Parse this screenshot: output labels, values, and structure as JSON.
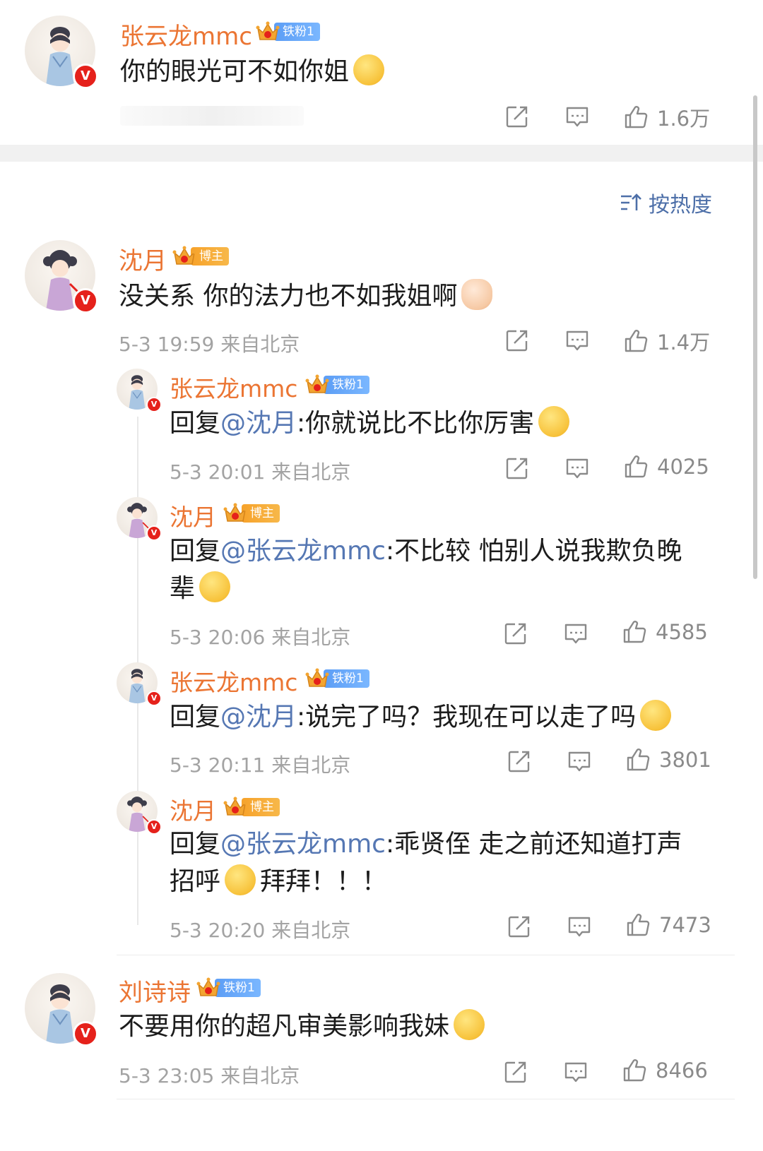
{
  "top_comment": {
    "name": "张云龙mmc",
    "badge": "铁粉1",
    "text": "你的眼光可不如你姐",
    "likes": "1.6万"
  },
  "sort": {
    "label": "按热度"
  },
  "comments": [
    {
      "name": "沈月",
      "badge": "博主",
      "text": "没关系 你的法力也不如我姐啊",
      "meta": "5-3 19:59 来自北京",
      "likes": "1.4万"
    }
  ],
  "replies": [
    {
      "name": "张云龙mmc",
      "badge": "铁粉1",
      "prefix": "回复",
      "mention": "@沈月",
      "text": ":你就说比不比你厉害",
      "meta": "5-3 20:01 来自北京",
      "likes": "4025"
    },
    {
      "name": "沈月",
      "badge": "博主",
      "prefix": "回复",
      "mention": "@张云龙mmc",
      "text": ":不比较 怕别人说我欺负晚",
      "text2": "辈",
      "meta": "5-3 20:06 来自北京",
      "likes": "4585"
    },
    {
      "name": "张云龙mmc",
      "badge": "铁粉1",
      "prefix": "回复",
      "mention": "@沈月",
      "text": ":说完了吗？我现在可以走了吗",
      "meta": "5-3 20:11 来自北京",
      "likes": "3801"
    },
    {
      "name": "沈月",
      "badge": "博主",
      "prefix": "回复",
      "mention": "@张云龙mmc",
      "text": ":乖贤侄 走之前还知道打声",
      "text2": "招呼",
      "text2b": "拜拜！！！",
      "meta": "5-3 20:20 来自北京",
      "likes": "7473"
    }
  ],
  "bottom_comment": {
    "name": "刘诗诗",
    "badge": "铁粉1",
    "text": "不要用你的超凡审美影响我妹",
    "meta": "5-3 23:05 来自北京",
    "likes": "8466"
  },
  "colors": {
    "name": "#eb7533",
    "mention": "#5577b3",
    "meta": "#a3a3a3",
    "verified": "#e5211b",
    "fan_badge": "#5c9df5",
    "blogger_badge": "#f7a22a"
  },
  "icons": [
    "share-icon",
    "comment-icon",
    "like-icon",
    "sort-icon",
    "verified-icon",
    "crown-icon"
  ]
}
